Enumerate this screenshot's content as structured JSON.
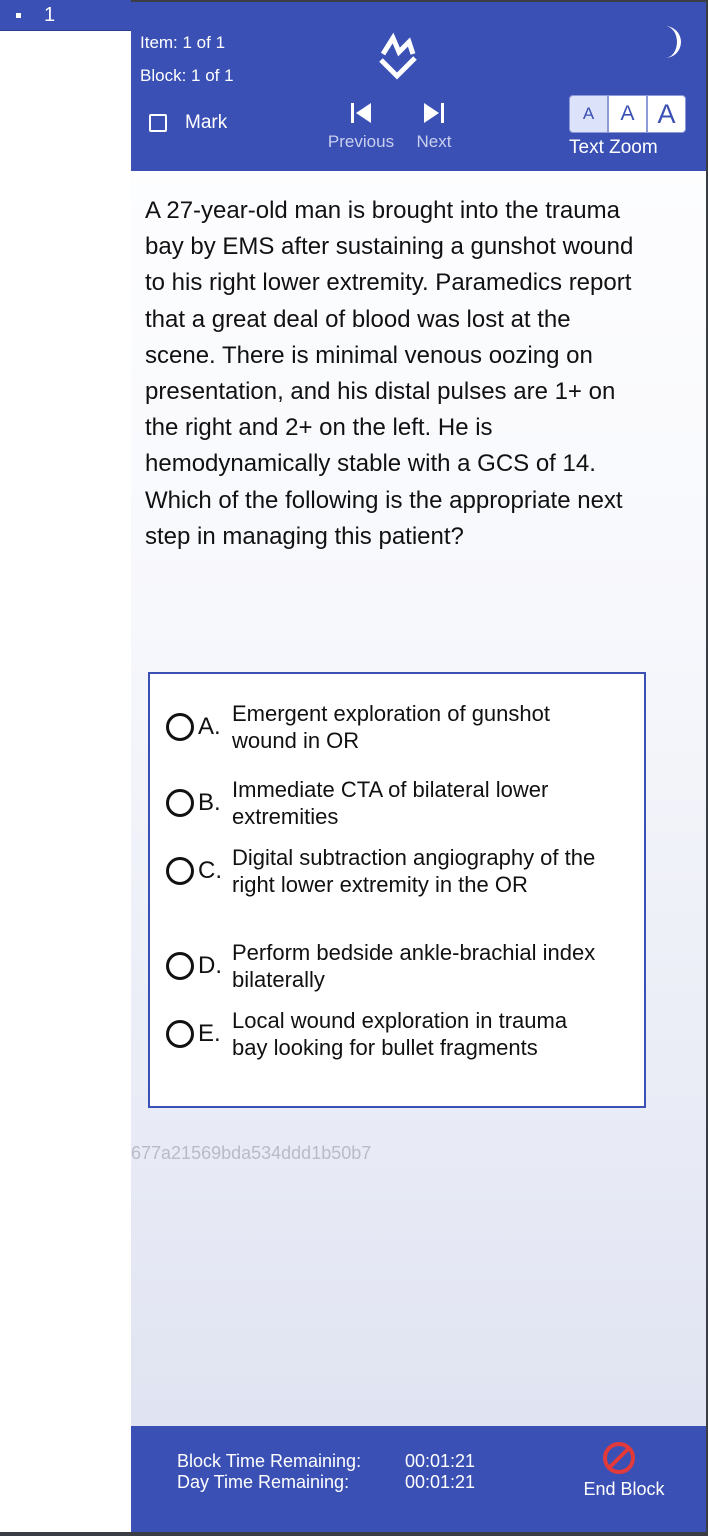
{
  "sidebar": {
    "current_number": "1"
  },
  "header": {
    "item_info": "Item: 1 of 1",
    "block_info": "Block: 1 of 1",
    "mark_label": "Mark",
    "previous_label": "Previous",
    "next_label": "Next",
    "zoom_small": "A",
    "zoom_medium": "A",
    "zoom_large": "A",
    "zoom_label": "Text Zoom"
  },
  "question": {
    "stem": "A 27-year-old man is brought into the trauma bay by EMS after sustaining a gunshot wound to his right lower extremity. Paramedics report that a great deal of blood was lost at the scene. There is minimal venous oozing on presentation, and his distal pulses are 1+ on the right and 2+ on the left. He is hemodynamically stable with a GCS of 14. Which of the following is the appropriate next step in managing this patient?",
    "answers": [
      {
        "letter": "A.",
        "text": "Emergent exploration of gunshot wound in OR"
      },
      {
        "letter": "B.",
        "text": "Immediate CTA of bilateral lower extremities"
      },
      {
        "letter": "C.",
        "text": "Digital subtraction angiography of the right lower extremity in the OR"
      },
      {
        "letter": "D.",
        "text": "Perform bedside ankle-brachial index bilaterally"
      },
      {
        "letter": "E.",
        "text": "Local wound exploration in trauma bay looking for bullet fragments"
      }
    ],
    "id": "677a21569bda534ddd1b50b7"
  },
  "footer": {
    "block_time_label": "Block Time Remaining:",
    "block_time_value": "00:01:21",
    "day_time_label": "Day Time Remaining:",
    "day_time_value": "00:01:21",
    "end_block_label": "End Block"
  },
  "colors": {
    "brand": "#3a50b4",
    "end_block_icon": "#e23a3a"
  },
  "icons": [
    "logo-icon",
    "moon-icon",
    "checkbox-icon",
    "previous-icon",
    "next-icon",
    "end-block-icon"
  ]
}
